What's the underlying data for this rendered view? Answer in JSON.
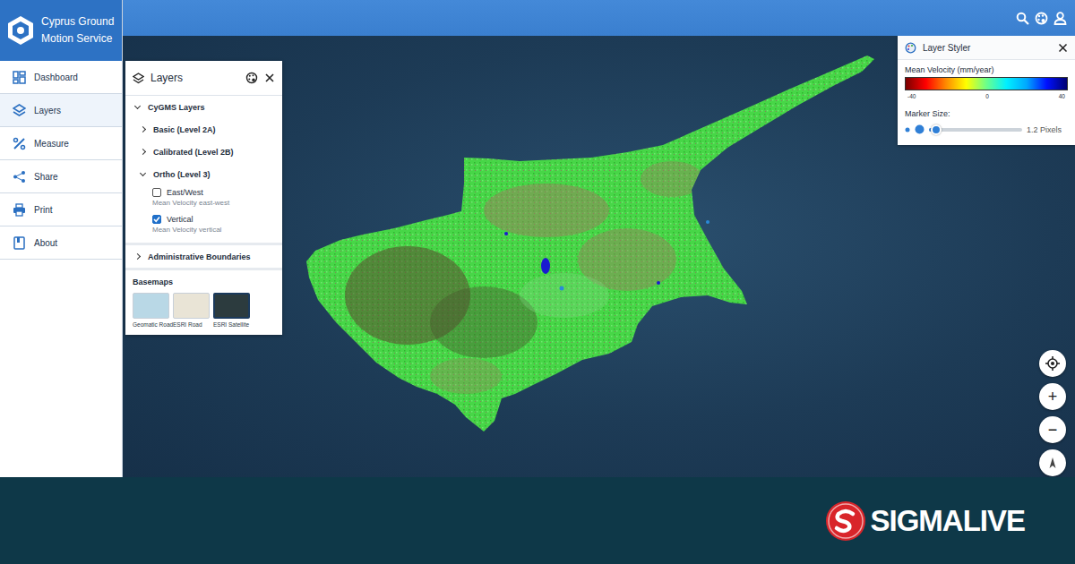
{
  "app": {
    "title": "Cyprus Ground Motion Service"
  },
  "sidebar": {
    "items": [
      {
        "label": "Dashboard",
        "selected": false
      },
      {
        "label": "Layers",
        "selected": true
      },
      {
        "label": "Measure",
        "selected": false
      },
      {
        "label": "Share",
        "selected": false
      },
      {
        "label": "Print",
        "selected": false
      },
      {
        "label": "About",
        "selected": false
      }
    ]
  },
  "layers_panel": {
    "title": "Layers",
    "groups": [
      {
        "label": "CyGMS Layers",
        "expanded": true,
        "subgroups": [
          {
            "label": "Basic (Level 2A)",
            "expanded": false,
            "layers": []
          },
          {
            "label": "Calibrated (Level 2B)",
            "expanded": false,
            "layers": []
          },
          {
            "label": "Ortho (Level 3)",
            "expanded": true,
            "layers": [
              {
                "label": "East/West",
                "description": "Mean Velocity east-west",
                "checked": false
              },
              {
                "label": "Vertical",
                "description": "Mean Velocity vertical",
                "checked": true
              }
            ]
          }
        ]
      },
      {
        "label": "Administrative Boundaries",
        "expanded": false,
        "subgroups": []
      }
    ],
    "basemaps": {
      "title": "Basemaps",
      "items": [
        {
          "label": "Geomatic Road",
          "selected": false,
          "color": "#b9d8e6"
        },
        {
          "label": "ESRI Road",
          "selected": false,
          "color": "#e9e4d6"
        },
        {
          "label": "ESRI Satellite",
          "selected": true,
          "color": "#2c3b3e"
        }
      ]
    }
  },
  "layer_styler": {
    "title": "Layer Styler",
    "legend_title": "Mean Velocity (mm/year)",
    "ticks": [
      "-40",
      "0",
      "40"
    ],
    "marker_size": {
      "label": "Marker Size:",
      "level": 0.08,
      "reading": "1.2 Pixels"
    }
  },
  "map_controls": {
    "zoom_in": "+",
    "zoom_out": "−"
  },
  "footer": {
    "brand": "SIGMALIVE"
  }
}
